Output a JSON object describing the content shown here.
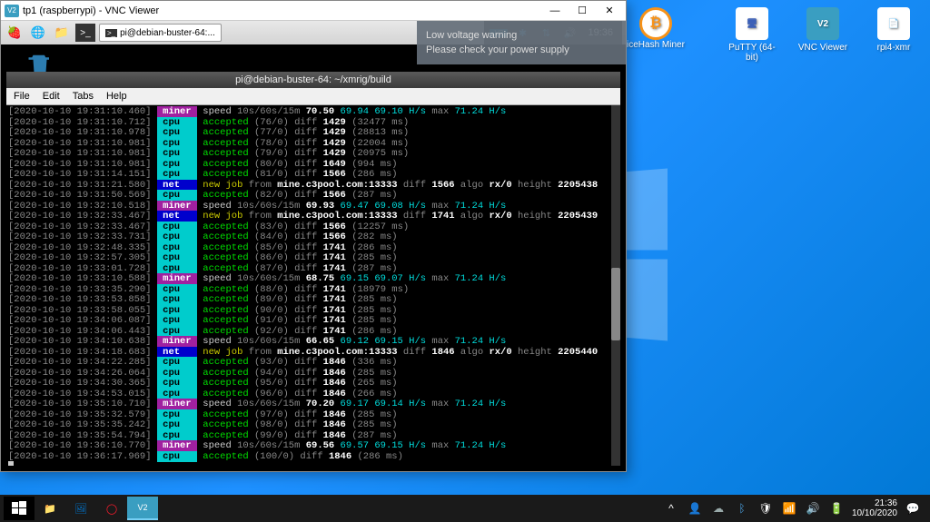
{
  "vnc": {
    "title": "tp1 (raspberrypi) - VNC Viewer"
  },
  "pi": {
    "tab": "pi@debian-buster-64:...",
    "time": "19:36",
    "warning_title": "Low voltage warning",
    "warning_body": "Please check your power supply"
  },
  "term": {
    "title": "pi@debian-buster-64: ~/xmrig/build",
    "menu": [
      "File",
      "Edit",
      "Tabs",
      "Help"
    ]
  },
  "desktop": {
    "icons": [
      "PuTTY (64-bit)",
      "VNC Viewer",
      "rpi4-xmr"
    ],
    "nicehash": "iceHash Miner"
  },
  "taskbar": {
    "time": "21:36",
    "date": "10/10/2020"
  },
  "log": [
    {
      "ts": "[2020-10-10 19:31:10.460]",
      "tag": "miner",
      "txt": " speed 10s/60s/15m 70.50 69.94 69.10 H/s max 71.24 H/s",
      "type": "speed",
      "v": [
        "70.50",
        "69.94",
        "69.10",
        "71.24"
      ]
    },
    {
      "ts": "[2020-10-10 19:31:10.712]",
      "tag": "cpu",
      "txt": " accepted (76/0) diff 1429 (32477 ms)",
      "type": "acc",
      "n": "76",
      "d": "1429",
      "ms": "32477"
    },
    {
      "ts": "[2020-10-10 19:31:10.978]",
      "tag": "cpu",
      "txt": " accepted (77/0) diff 1429 (28813 ms)",
      "type": "acc",
      "n": "77",
      "d": "1429",
      "ms": "28813"
    },
    {
      "ts": "[2020-10-10 19:31:10.981]",
      "tag": "cpu",
      "txt": " accepted (78/0) diff 1429 (22004 ms)",
      "type": "acc",
      "n": "78",
      "d": "1429",
      "ms": "22004"
    },
    {
      "ts": "[2020-10-10 19:31:10.981]",
      "tag": "cpu",
      "txt": " accepted (79/0) diff 1429 (20975 ms)",
      "type": "acc",
      "n": "79",
      "d": "1429",
      "ms": "20975"
    },
    {
      "ts": "[2020-10-10 19:31:10.981]",
      "tag": "cpu",
      "txt": " accepted (80/0) diff 1649 (994 ms)",
      "type": "acc",
      "n": "80",
      "d": "1649",
      "ms": "994"
    },
    {
      "ts": "[2020-10-10 19:31:14.151]",
      "tag": "cpu",
      "txt": " accepted (81/0) diff 1566 (286 ms)",
      "type": "acc",
      "n": "81",
      "d": "1566",
      "ms": "286"
    },
    {
      "ts": "[2020-10-10 19:31:21.580]",
      "tag": "net",
      "txt": " new job from mine.c3pool.com:13333 diff 1566 algo rx/0 height 2205438",
      "type": "job",
      "h": "2205438",
      "d": "1566"
    },
    {
      "ts": "[2020-10-10 19:31:50.569]",
      "tag": "cpu",
      "txt": " accepted (82/0) diff 1566 (287 ms)",
      "type": "acc",
      "n": "82",
      "d": "1566",
      "ms": "287"
    },
    {
      "ts": "[2020-10-10 19:32:10.518]",
      "tag": "miner",
      "txt": " speed 10s/60s/15m 69.93 69.47 69.08 H/s max 71.24 H/s",
      "type": "speed",
      "v": [
        "69.93",
        "69.47",
        "69.08",
        "71.24"
      ]
    },
    {
      "ts": "[2020-10-10 19:32:33.467]",
      "tag": "net",
      "txt": " new job from mine.c3pool.com:13333 diff 1741 algo rx/0 height 2205439",
      "type": "job",
      "h": "2205439",
      "d": "1741"
    },
    {
      "ts": "[2020-10-10 19:32:33.467]",
      "tag": "cpu",
      "txt": " accepted (83/0) diff 1566 (12257 ms)",
      "type": "acc",
      "n": "83",
      "d": "1566",
      "ms": "12257"
    },
    {
      "ts": "[2020-10-10 19:32:33.731]",
      "tag": "cpu",
      "txt": " accepted (84/0) diff 1566 (282 ms)",
      "type": "acc",
      "n": "84",
      "d": "1566",
      "ms": "282"
    },
    {
      "ts": "[2020-10-10 19:32:48.335]",
      "tag": "cpu",
      "txt": " accepted (85/0) diff 1741 (286 ms)",
      "type": "acc",
      "n": "85",
      "d": "1741",
      "ms": "286"
    },
    {
      "ts": "[2020-10-10 19:32:57.305]",
      "tag": "cpu",
      "txt": " accepted (86/0) diff 1741 (285 ms)",
      "type": "acc",
      "n": "86",
      "d": "1741",
      "ms": "285"
    },
    {
      "ts": "[2020-10-10 19:33:01.728]",
      "tag": "cpu",
      "txt": " accepted (87/0) diff 1741 (287 ms)",
      "type": "acc",
      "n": "87",
      "d": "1741",
      "ms": "287"
    },
    {
      "ts": "[2020-10-10 19:33:10.588]",
      "tag": "miner",
      "txt": " speed 10s/60s/15m 68.75 69.15 69.07 H/s max 71.24 H/s",
      "type": "speed",
      "v": [
        "68.75",
        "69.15",
        "69.07",
        "71.24"
      ]
    },
    {
      "ts": "[2020-10-10 19:33:35.290]",
      "tag": "cpu",
      "txt": " accepted (88/0) diff 1741 (18979 ms)",
      "type": "acc",
      "n": "88",
      "d": "1741",
      "ms": "18979"
    },
    {
      "ts": "[2020-10-10 19:33:53.858]",
      "tag": "cpu",
      "txt": " accepted (89/0) diff 1741 (285 ms)",
      "type": "acc",
      "n": "89",
      "d": "1741",
      "ms": "285"
    },
    {
      "ts": "[2020-10-10 19:33:58.055]",
      "tag": "cpu",
      "txt": " accepted (90/0) diff 1741 (285 ms)",
      "type": "acc",
      "n": "90",
      "d": "1741",
      "ms": "285"
    },
    {
      "ts": "[2020-10-10 19:34:06.087]",
      "tag": "cpu",
      "txt": " accepted (91/0) diff 1741 (285 ms)",
      "type": "acc",
      "n": "91",
      "d": "1741",
      "ms": "285"
    },
    {
      "ts": "[2020-10-10 19:34:06.443]",
      "tag": "cpu",
      "txt": " accepted (92/0) diff 1741 (286 ms)",
      "type": "acc",
      "n": "92",
      "d": "1741",
      "ms": "286"
    },
    {
      "ts": "[2020-10-10 19:34:10.638]",
      "tag": "miner",
      "txt": " speed 10s/60s/15m 66.65 69.12 69.15 H/s max 71.24 H/s",
      "type": "speed",
      "v": [
        "66.65",
        "69.12",
        "69.15",
        "71.24"
      ]
    },
    {
      "ts": "[2020-10-10 19:34:18.683]",
      "tag": "net",
      "txt": " new job from mine.c3pool.com:13333 diff 1846 algo rx/0 height 2205440",
      "type": "job",
      "h": "2205440",
      "d": "1846"
    },
    {
      "ts": "[2020-10-10 19:34:22.285]",
      "tag": "cpu",
      "txt": " accepted (93/0) diff 1846 (336 ms)",
      "type": "acc",
      "n": "93",
      "d": "1846",
      "ms": "336"
    },
    {
      "ts": "[2020-10-10 19:34:26.064]",
      "tag": "cpu",
      "txt": " accepted (94/0) diff 1846 (285 ms)",
      "type": "acc",
      "n": "94",
      "d": "1846",
      "ms": "285"
    },
    {
      "ts": "[2020-10-10 19:34:30.365]",
      "tag": "cpu",
      "txt": " accepted (95/0) diff 1846 (265 ms)",
      "type": "acc",
      "n": "95",
      "d": "1846",
      "ms": "265"
    },
    {
      "ts": "[2020-10-10 19:34:53.015]",
      "tag": "cpu",
      "txt": " accepted (96/0) diff 1846 (266 ms)",
      "type": "acc",
      "n": "96",
      "d": "1846",
      "ms": "266"
    },
    {
      "ts": "[2020-10-10 19:35:10.710]",
      "tag": "miner",
      "txt": " speed 10s/60s/15m 70.20 69.17 69.14 H/s max 71.24 H/s",
      "type": "speed",
      "v": [
        "70.20",
        "69.17",
        "69.14",
        "71.24"
      ]
    },
    {
      "ts": "[2020-10-10 19:35:32.579]",
      "tag": "cpu",
      "txt": " accepted (97/0) diff 1846 (285 ms)",
      "type": "acc",
      "n": "97",
      "d": "1846",
      "ms": "285"
    },
    {
      "ts": "[2020-10-10 19:35:35.242]",
      "tag": "cpu",
      "txt": " accepted (98/0) diff 1846 (285 ms)",
      "type": "acc",
      "n": "98",
      "d": "1846",
      "ms": "285"
    },
    {
      "ts": "[2020-10-10 19:35:54.794]",
      "tag": "cpu",
      "txt": " accepted (99/0) diff 1846 (287 ms)",
      "type": "acc",
      "n": "99",
      "d": "1846",
      "ms": "287"
    },
    {
      "ts": "[2020-10-10 19:36:10.770]",
      "tag": "miner",
      "txt": " speed 10s/60s/15m 69.56 69.57 69.15 H/s max 71.24 H/s",
      "type": "speed",
      "v": [
        "69.56",
        "69.57",
        "69.15",
        "71.24"
      ]
    },
    {
      "ts": "[2020-10-10 19:36:17.969]",
      "tag": "cpu",
      "txt": " accepted (100/0) diff 1846 (286 ms)",
      "type": "acc",
      "n": "100",
      "d": "1846",
      "ms": "286"
    }
  ]
}
